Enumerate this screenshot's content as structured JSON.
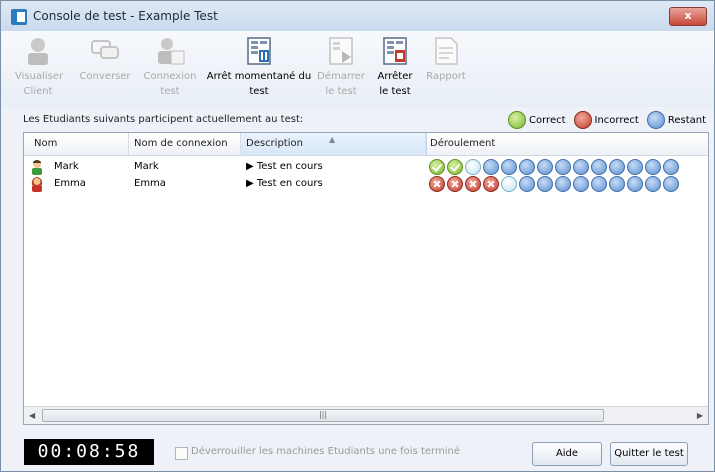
{
  "window": {
    "title": "Console de test - Example Test",
    "close_label": "x"
  },
  "toolbar": {
    "buttons": [
      {
        "line1": "Visualiser",
        "line2": "Client",
        "enabled": false
      },
      {
        "line1": "Converser",
        "line2": "",
        "enabled": false
      },
      {
        "line1": "Connexion",
        "line2": "test",
        "enabled": false
      },
      {
        "line1": "Arrêt momentané du",
        "line2": "test",
        "enabled": true
      },
      {
        "line1": "Démarrer",
        "line2": "le test",
        "enabled": false
      },
      {
        "line1": "Arrêter",
        "line2": "le test",
        "enabled": true
      },
      {
        "line1": "Rapport",
        "line2": "",
        "enabled": false
      }
    ]
  },
  "prompt": "Les Etudiants suivants participent actuellement au test:",
  "legend": {
    "correct": "Correct",
    "incorrect": "Incorrect",
    "remaining": "Restant"
  },
  "table": {
    "columns": [
      "Nom",
      "Nom de connexion",
      "Description",
      "Déroulement"
    ],
    "rows": [
      {
        "name": "Mark",
        "login": "Mark",
        "description": "▶ Test en cours",
        "progress": [
          "correct",
          "correct",
          "current",
          "remaining",
          "remaining",
          "remaining",
          "remaining",
          "remaining",
          "remaining",
          "remaining",
          "remaining",
          "remaining",
          "remaining",
          "remaining"
        ]
      },
      {
        "name": "Emma",
        "login": "Emma",
        "description": "▶ Test en cours",
        "progress": [
          "incorrect",
          "incorrect",
          "incorrect",
          "incorrect",
          "current",
          "remaining",
          "remaining",
          "remaining",
          "remaining",
          "remaining",
          "remaining",
          "remaining",
          "remaining",
          "remaining"
        ]
      }
    ]
  },
  "timer": "00:08:58",
  "unlock_label": "Déverrouiller les machines Etudiants une fois terminé",
  "buttons": {
    "help": "Aide",
    "quit": "Quitter le test"
  }
}
